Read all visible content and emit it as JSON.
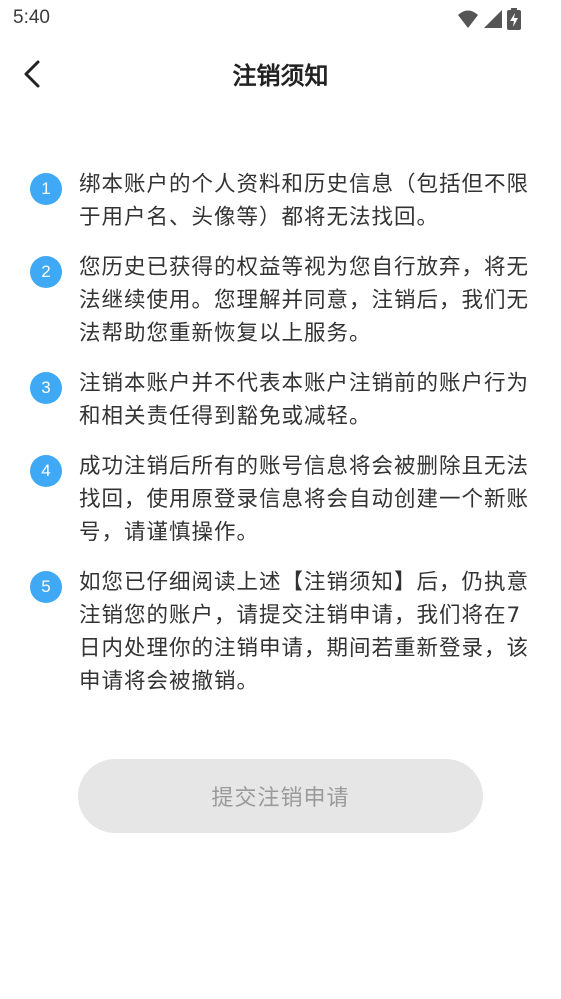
{
  "status_bar": {
    "time": "5:40",
    "icons": [
      "wifi-icon",
      "signal-icon",
      "battery-charging-icon"
    ]
  },
  "nav": {
    "title": "注销须知",
    "back_icon": "back-arrow-icon"
  },
  "notices": [
    {
      "num": "1",
      "text": "绑本账户的个人资料和历史信息（包括但不限于用户名、头像等）都将无法找回。"
    },
    {
      "num": "2",
      "text": "您历史已获得的权益等视为您自行放弃，将无法继续使用。您理解并同意，注销后，我们无法帮助您重新恢复以上服务。"
    },
    {
      "num": "3",
      "text": "注销本账户并不代表本账户注销前的账户行为和相关责任得到豁免或减轻。"
    },
    {
      "num": "4",
      "text": "成功注销后所有的账号信息将会被删除且无法找回，使用原登录信息将会自动创建一个新账号，请谨慎操作。"
    },
    {
      "num": "5",
      "text": "如您已仔细阅读上述【注销须知】后，仍执意注销您的账户，请提交注销申请，我们将在7日内处理你的注销申请，期间若重新登录，该申请将会被撤销。"
    }
  ],
  "submit_button": {
    "label": "提交注销申请"
  },
  "colors": {
    "accent": "#3fa9f5",
    "button_bg": "#e6e6e6",
    "button_text": "#9a9a9a"
  }
}
